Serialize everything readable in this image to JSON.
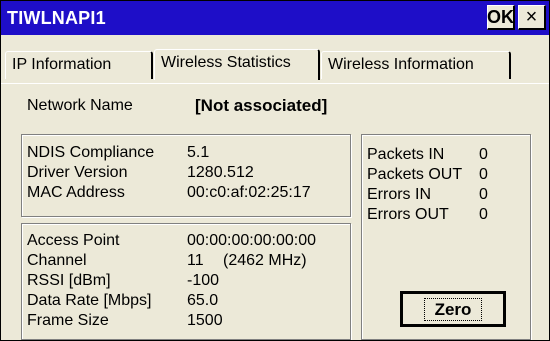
{
  "window": {
    "title": "TIWLNAPI1",
    "ok_label": "OK",
    "close_label": "×"
  },
  "tabs": [
    {
      "label": "IP Information"
    },
    {
      "label": "Wireless Statistics"
    },
    {
      "label": "Wireless Information"
    }
  ],
  "network": {
    "label": "Network Name",
    "value": "[Not associated]"
  },
  "driver": {
    "ndis_label": "NDIS Compliance",
    "ndis_value": "5.1",
    "version_label": "Driver Version",
    "version_value": "1280.512",
    "mac_label": "MAC Address",
    "mac_value": "00:c0:af:02:25:17"
  },
  "link": {
    "ap_label": "Access Point",
    "ap_value": "00:00:00:00:00:00",
    "channel_label": "Channel",
    "channel_value": "11",
    "channel_freq": "(2462 MHz)",
    "rssi_label": "RSSI [dBm]",
    "rssi_value": "-100",
    "rate_label": "Data Rate [Mbps]",
    "rate_value": "65.0",
    "frame_label": "Frame Size",
    "frame_value": "1500"
  },
  "counters": {
    "packets_in_label": "Packets IN",
    "packets_in_value": "0",
    "packets_out_label": "Packets OUT",
    "packets_out_value": "0",
    "errors_in_label": "Errors IN",
    "errors_in_value": "0",
    "errors_out_label": "Errors OUT",
    "errors_out_value": "0",
    "zero_label": "Zero"
  }
}
